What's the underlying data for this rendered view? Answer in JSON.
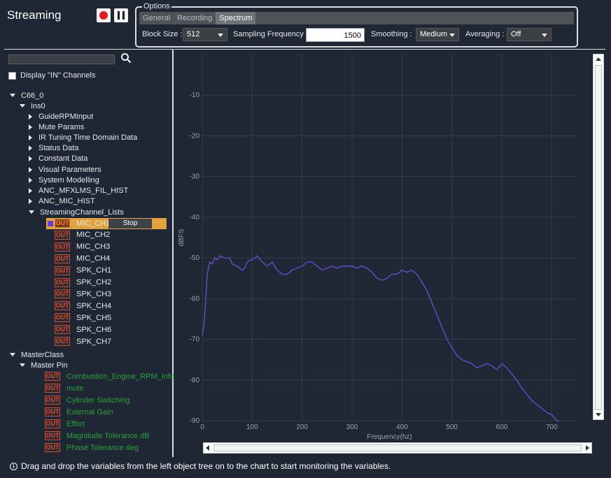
{
  "header": {
    "title": "Streaming"
  },
  "options": {
    "legend": "Options",
    "tabs": [
      "General",
      "Recording",
      "Spectrum"
    ],
    "active_tab": "Spectrum",
    "block_size_label": "Block Size :",
    "block_size_value": "512",
    "sampling_frequency_label": "Sampling Frequency :",
    "sampling_frequency_value": "1500",
    "smoothing_label": "Smoothing :",
    "smoothing_value": "Medium",
    "averaging_label": "Averaging :",
    "averaging_value": "Off"
  },
  "left_panel": {
    "search_placeholder": "",
    "display_in_channels_label": "Display \"IN\" Channels",
    "out_badge": "OUT",
    "stop_label": "Stop",
    "tree": {
      "root": "C66_0",
      "ins0": "Ins0",
      "ins0_children": [
        "GuideRPMInput",
        "Mute Params",
        "IR Tuning Time Domain Data",
        "Status Data",
        "Constant Data",
        "Visual Parameters",
        "System Modelling",
        "ANC_MFXLMS_FIL_HIST",
        "ANC_MIC_HIST"
      ],
      "streaming_lists": "StreamingChannel_Lists",
      "channels": [
        "MIC_CH1",
        "MIC_CH2",
        "MIC_CH3",
        "MIC_CH4",
        "SPK_CH1",
        "SPK_CH2",
        "SPK_CH3",
        "SPK_CH4",
        "SPK_CH5",
        "SPK_CH6",
        "SPK_CH7"
      ],
      "master_class": "MasterClass",
      "master_pin": "Master Pin",
      "master_pins": [
        "Combustion_Engine_RPM_Info",
        "mute",
        "Cylinder Switching",
        "External Gain",
        "Effort",
        "Magnitude Tolerance dB",
        "Phase Tolerance deg"
      ]
    }
  },
  "colors": {
    "background": "#1e2733",
    "series_line": "#6a4fd8",
    "out_badge": "#e3452b",
    "selected_row": "#e2a23d",
    "master_pin_text": "#2aa13a"
  },
  "chart_data": {
    "type": "line",
    "xlabel": "Frequency(hz)",
    "ylabel": "dBFS",
    "xlim": [
      0,
      750
    ],
    "ylim": [
      -90,
      0
    ],
    "x_ticks": [
      0,
      100,
      200,
      300,
      400,
      500,
      600,
      700
    ],
    "y_ticks": [
      -10,
      -20,
      -30,
      -40,
      -50,
      -60,
      -70,
      -80,
      -90
    ],
    "grid": true,
    "series": [
      {
        "x": [
          0,
          3,
          6,
          10,
          15,
          20,
          25,
          30,
          35,
          45,
          55,
          60,
          70,
          80,
          85,
          90,
          95,
          100,
          110,
          120,
          130,
          140,
          150,
          160,
          170,
          180,
          190,
          200,
          210,
          220,
          230,
          240,
          250,
          260,
          270,
          280,
          290,
          300,
          310,
          320,
          330,
          340,
          350,
          360,
          370,
          380,
          390,
          400,
          410,
          420,
          430,
          440,
          450,
          460,
          470,
          480,
          490,
          500,
          510,
          520,
          530,
          540,
          550,
          560,
          570,
          580,
          590,
          600,
          610,
          620,
          630,
          640,
          650,
          660,
          670,
          680,
          690,
          700,
          710,
          715
        ],
        "y": [
          -69,
          -67,
          -62,
          -54,
          -51,
          -51.5,
          -50,
          -50.5,
          -49.5,
          -50,
          -50,
          -51.5,
          -52,
          -53,
          -52.5,
          -51,
          -50.5,
          -50.5,
          -49.5,
          -51,
          -52,
          -51,
          -53,
          -54,
          -54,
          -53,
          -52.5,
          -52,
          -51,
          -51,
          -52,
          -53,
          -52.5,
          -52,
          -52.5,
          -52,
          -52,
          -52,
          -52.5,
          -52,
          -52.5,
          -53.5,
          -55,
          -55.5,
          -55,
          -54,
          -54,
          -53,
          -53.5,
          -53,
          -54,
          -56,
          -58,
          -61,
          -64,
          -67,
          -70,
          -72,
          -74,
          -75,
          -75.5,
          -76,
          -77,
          -76.5,
          -76,
          -76.5,
          -77.5,
          -76,
          -77,
          -78.5,
          -80,
          -82,
          -83.5,
          -85,
          -86,
          -87,
          -88,
          -88.5,
          -90,
          -90
        ]
      }
    ]
  },
  "footer": {
    "hint": "Drag and drop the variables from the left object tree on to the chart to start monitoring the variables."
  }
}
